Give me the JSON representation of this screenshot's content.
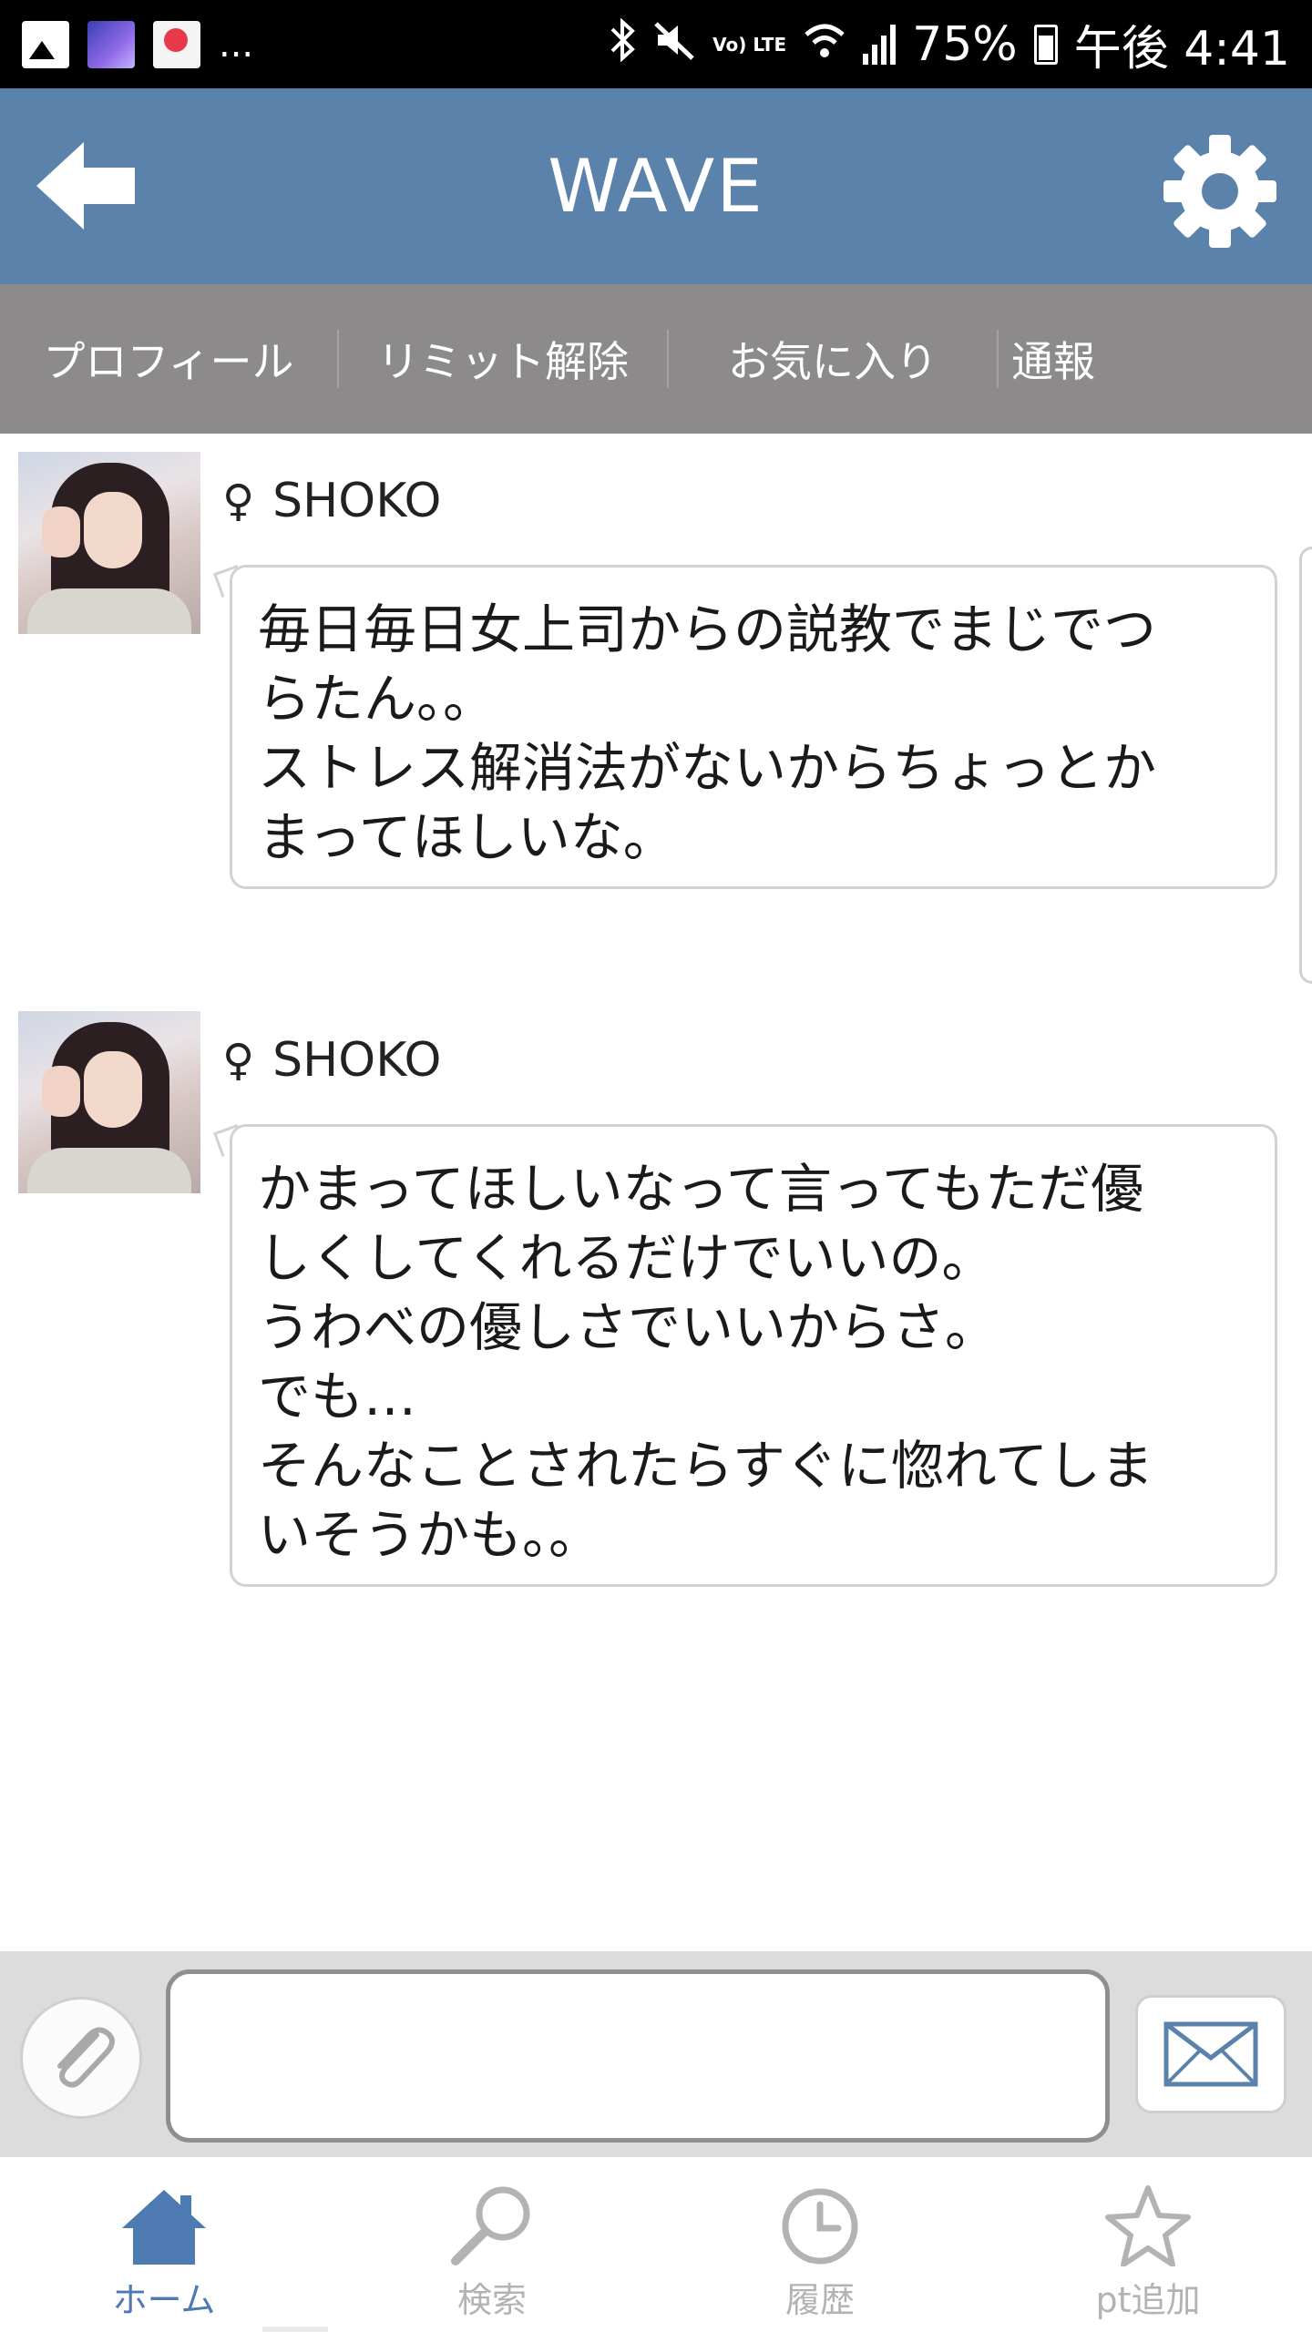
{
  "status_bar": {
    "network": "Vo) LTE",
    "battery": "75%",
    "time": "午後 4:41",
    "more": "..."
  },
  "header": {
    "title": "WAVE"
  },
  "tabs": [
    {
      "label": "プロフィール"
    },
    {
      "label": "リミット解除"
    },
    {
      "label": "お気に入り"
    },
    {
      "label": "通報"
    }
  ],
  "messages": [
    {
      "sender": "SHOKO",
      "gender_symbol": "♀",
      "text": "毎日毎日女上司からの説教でまじでつ\nらたん。。\nストレス解消法がないからちょっとか\nまってほしいな。"
    },
    {
      "sender": "SHOKO",
      "gender_symbol": "♀",
      "text": "かまってほしいなって言ってもただ優\nしくしてくれるだけでいいの。\nうわべの優しさでいいからさ。\nでも…\nそんなことされたらすぐに惚れてしま\nいそうかも。。"
    }
  ],
  "compose": {
    "input_value": "",
    "input_placeholder": ""
  },
  "bottom_nav": [
    {
      "label": "ホーム",
      "icon": "home-icon",
      "active": true
    },
    {
      "label": "検索",
      "icon": "search-icon",
      "active": false
    },
    {
      "label": "履歴",
      "icon": "clock-icon",
      "active": false
    },
    {
      "label": "pt追加",
      "icon": "star-icon",
      "active": false
    }
  ],
  "colors": {
    "header_bg": "#5a82ab",
    "tab_bg": "#8c8a8b",
    "active_nav": "#4d7ab0",
    "inactive_nav": "#b3b3b3"
  }
}
